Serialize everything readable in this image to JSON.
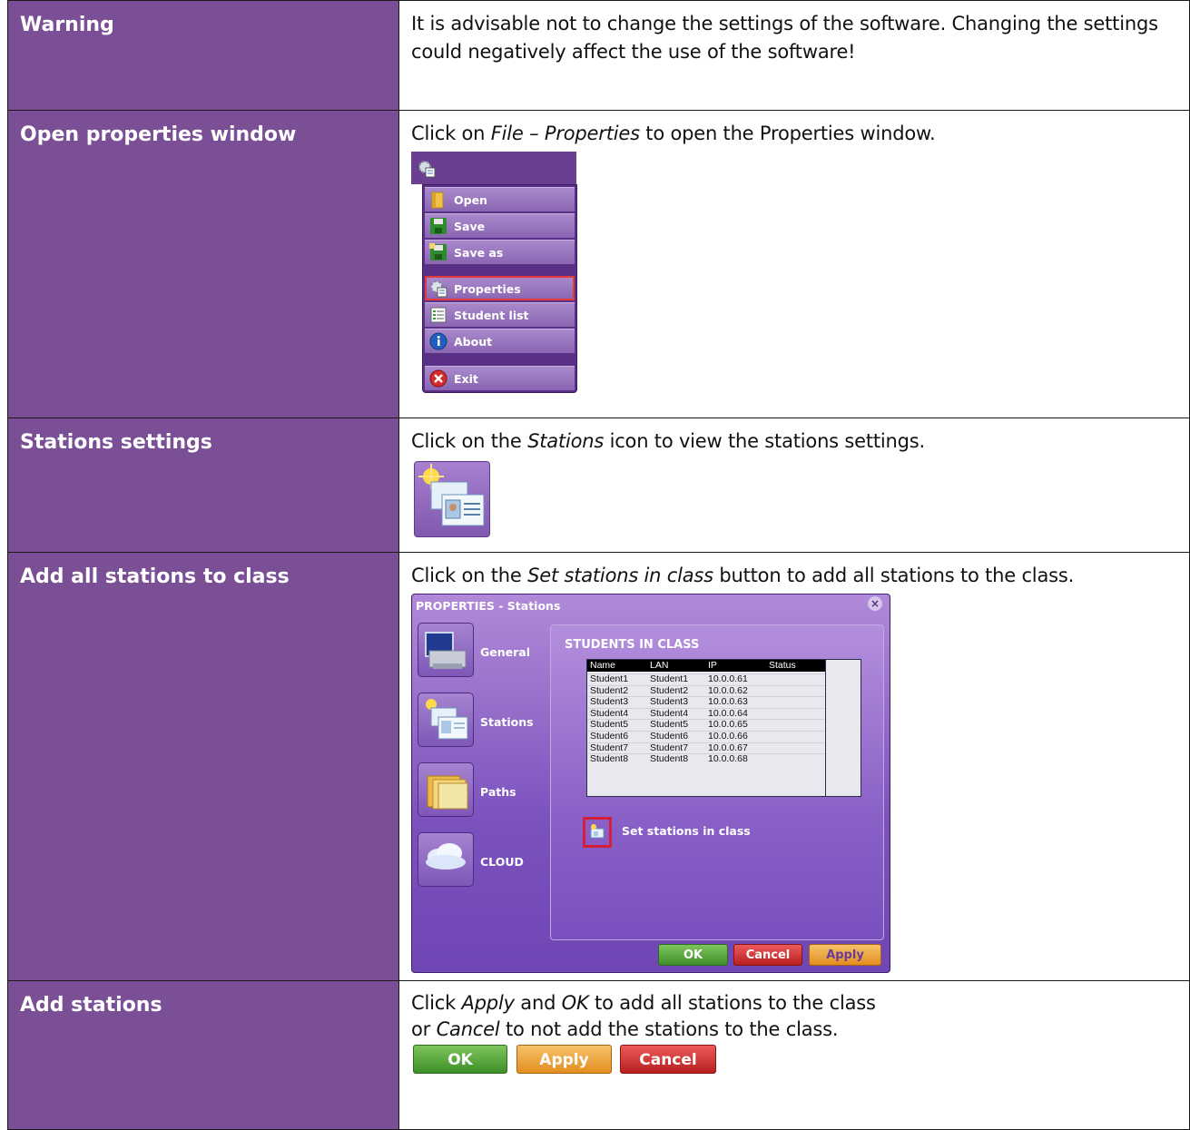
{
  "rows": [
    {
      "label": "Warning",
      "text": "It is advisable not to change the settings of the software. Changing the settings could negatively affect the use of the software!"
    },
    {
      "label": "Open properties window",
      "text_before": "Click on ",
      "text_em": "File – Properties",
      "text_after": " to open the Properties window.",
      "menu": {
        "items": [
          "Open",
          "Save",
          "Save as",
          "Properties",
          "Student list",
          "About",
          "Exit"
        ],
        "icons": [
          "folder-icon",
          "save-icon",
          "save-as-icon",
          "properties-icon",
          "student-list-icon",
          "info-icon",
          "exit-icon"
        ],
        "selected": "Properties"
      }
    },
    {
      "label": "Stations settings",
      "text_before": "Click on the ",
      "text_em": "Stations",
      "text_after": " icon to view the stations settings."
    },
    {
      "label": "Add all stations to class",
      "text_before": "Click on the ",
      "text_em": "Set stations in class",
      "text_after": " button to add all stations to the class.",
      "dialog": {
        "title": "PROPERTIES - Stations",
        "nav": [
          "General",
          "Stations",
          "Paths",
          "CLOUD"
        ],
        "section_title": "STUDENTS IN CLASS",
        "columns": [
          "Name",
          "LAN",
          "IP",
          "Status"
        ],
        "students": [
          [
            "Student1",
            "Student1",
            "10.0.0.61",
            ""
          ],
          [
            "Student2",
            "Student2",
            "10.0.0.62",
            ""
          ],
          [
            "Student3",
            "Student3",
            "10.0.0.63",
            ""
          ],
          [
            "Student4",
            "Student4",
            "10.0.0.64",
            ""
          ],
          [
            "Student5",
            "Student5",
            "10.0.0.65",
            ""
          ],
          [
            "Student6",
            "Student6",
            "10.0.0.66",
            ""
          ],
          [
            "Student7",
            "Student7",
            "10.0.0.67",
            ""
          ],
          [
            "Student8",
            "Student8",
            "10.0.0.68",
            ""
          ]
        ],
        "set_button_label": "Set stations in class",
        "ok": "OK",
        "cancel": "Cancel",
        "apply": "Apply"
      }
    },
    {
      "label": "Add stations",
      "line1_before": "Click ",
      "line1_em1": "Apply",
      "line1_mid": " and ",
      "line1_em2": "OK",
      "line1_after": " to add all stations to the class",
      "line2_before": "or ",
      "line2_em": "Cancel",
      "line2_after": " to not add the stations to the class.",
      "buttons": {
        "ok": "OK",
        "apply": "Apply",
        "cancel": "Cancel"
      }
    }
  ],
  "colors": {
    "label_bg": "#7a4f96",
    "ok": "#4e9b33",
    "cancel": "#cc2b2b",
    "apply": "#eaa23a",
    "highlight": "#e23a3a"
  }
}
